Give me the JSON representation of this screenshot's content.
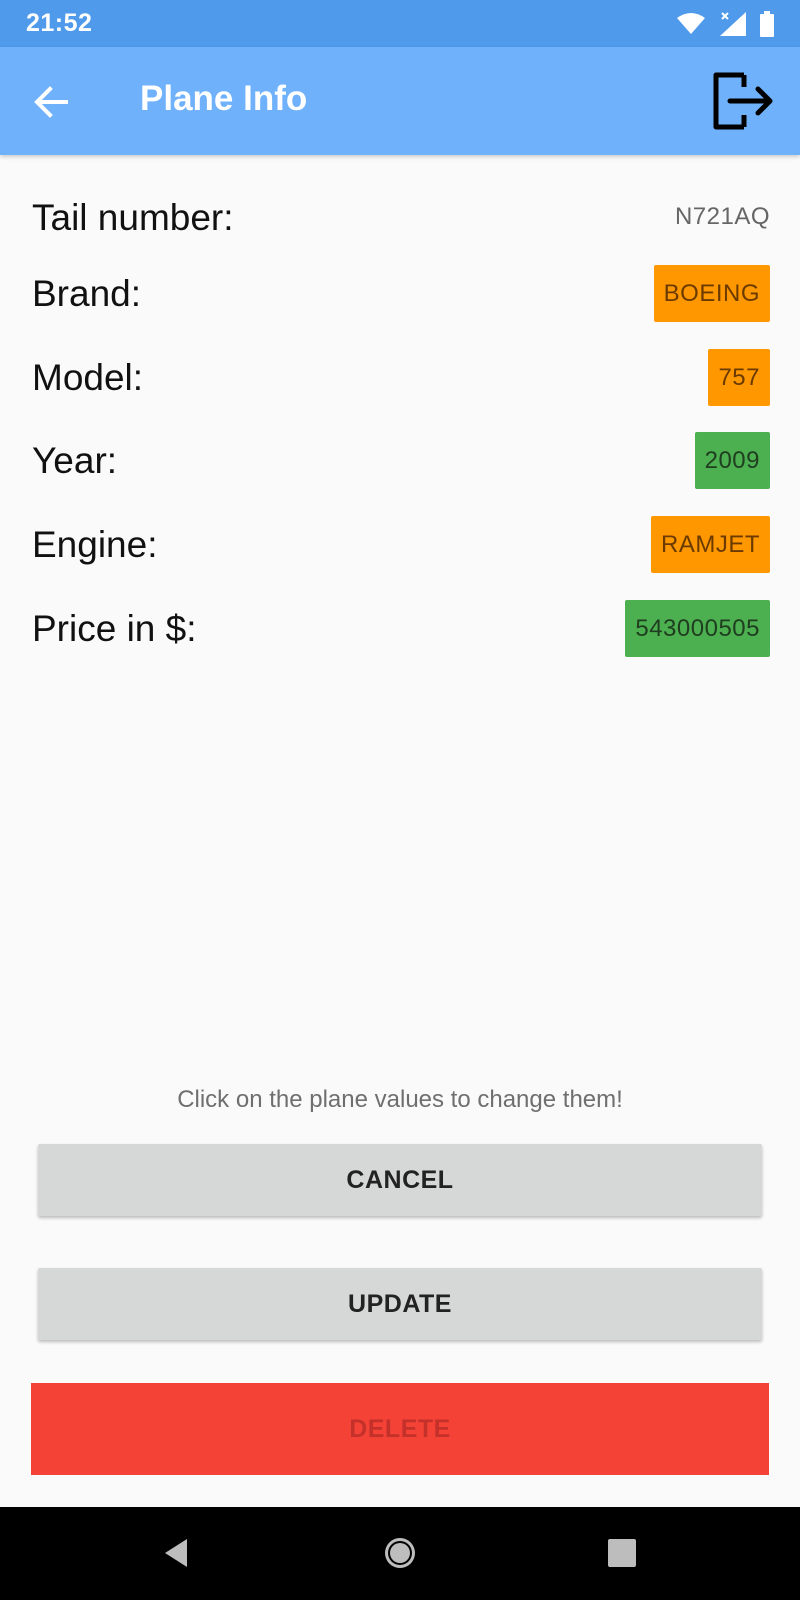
{
  "status_bar": {
    "time": "21:52"
  },
  "app_bar": {
    "title": "Plane Info"
  },
  "fields": {
    "tail_number": {
      "label": "Tail number:",
      "value": "N721AQ"
    },
    "brand": {
      "label": "Brand:",
      "value": "BOEING",
      "color": "#ff9800"
    },
    "model": {
      "label": "Model:",
      "value": "757",
      "color": "#ff9800"
    },
    "year": {
      "label": "Year:",
      "value": "2009",
      "color": "#4caf50"
    },
    "engine": {
      "label": "Engine:",
      "value": "RAMJET",
      "color": "#ff9800"
    },
    "price": {
      "label": "Price in $:",
      "value": "543000505",
      "color": "#4caf50"
    }
  },
  "hint": "Click on the plane values to change them!",
  "buttons": {
    "cancel": "CANCEL",
    "update": "UPDATE",
    "delete": "DELETE"
  },
  "colors": {
    "status_bar": "#4f9aea",
    "app_bar": "#6fb1fb",
    "delete": "#f44336"
  },
  "icons": {
    "back": "arrow-left-icon",
    "logout": "logout-icon"
  }
}
